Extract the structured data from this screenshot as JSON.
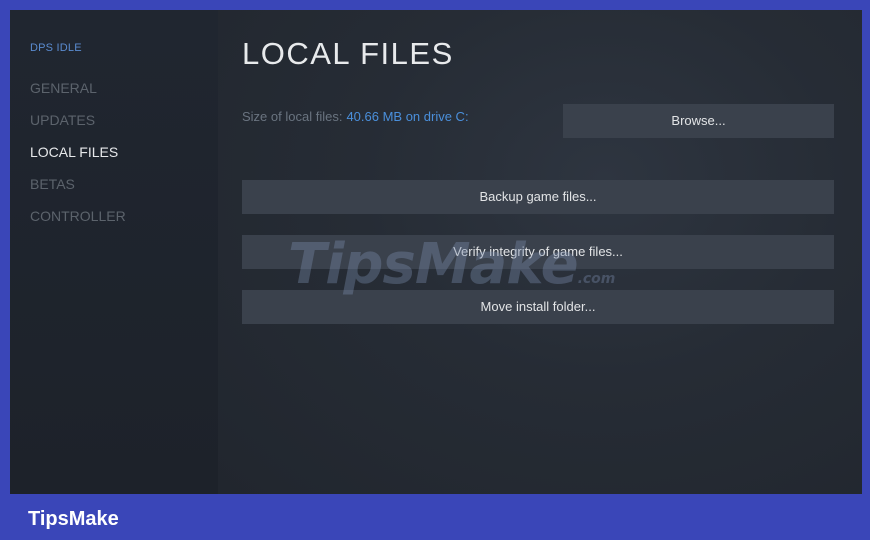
{
  "sidebar": {
    "game_name": "DPS IDLE",
    "items": [
      {
        "label": "GENERAL",
        "active": false
      },
      {
        "label": "UPDATES",
        "active": false
      },
      {
        "label": "LOCAL FILES",
        "active": true
      },
      {
        "label": "BETAS",
        "active": false
      },
      {
        "label": "CONTROLLER",
        "active": false
      }
    ]
  },
  "main": {
    "title": "LOCAL FILES",
    "size_label": "Size of local files:",
    "size_value": "40.66 MB on drive C:",
    "browse_label": "Browse...",
    "backup_label": "Backup game files...",
    "verify_label": "Verify integrity of game files...",
    "move_label": "Move install folder..."
  },
  "watermark": {
    "text": "TipsMake",
    "suffix": ".com"
  },
  "footer": {
    "brand": "TipsMake"
  },
  "colors": {
    "border": "#3a46b8",
    "accent_link": "#4a8fdb",
    "button_bg": "#3a414c"
  }
}
